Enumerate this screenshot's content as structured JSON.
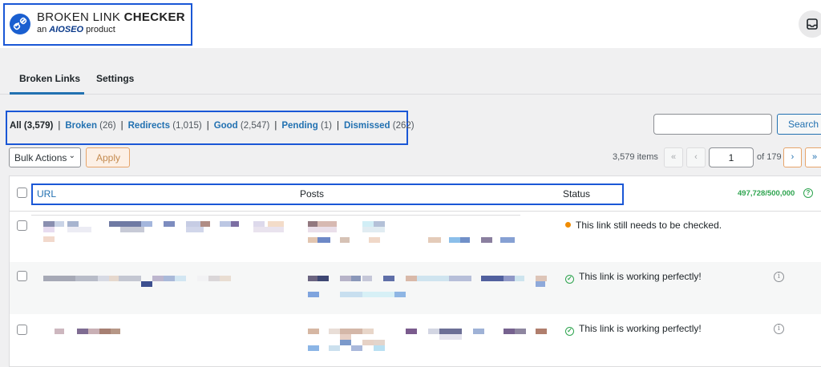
{
  "header": {
    "logo_text_light": "BROKEN LINK ",
    "logo_text_bold": "CHECKER",
    "logo_sub_prefix": "an ",
    "logo_sub_brand": "AIOSEO",
    "logo_sub_suffix": " product",
    "inbox_icon": "inbox-icon"
  },
  "tabs": [
    {
      "label": "Broken Links",
      "active": true
    },
    {
      "label": "Settings",
      "active": false
    }
  ],
  "filters": {
    "all_label": "All",
    "all_count": "(3,579)",
    "broken_label": "Broken",
    "broken_count": "(26)",
    "redirects_label": "Redirects",
    "redirects_count": "(1,015)",
    "good_label": "Good",
    "good_count": "(2,547)",
    "pending_label": "Pending",
    "pending_count": "(1)",
    "dismissed_label": "Dismissed",
    "dismissed_count": "(262)",
    "separator": "|"
  },
  "search": {
    "placeholder": "",
    "button_label": "Search"
  },
  "toolbar": {
    "bulk_actions_label": "Bulk Actions",
    "apply_label": "Apply"
  },
  "pagination": {
    "items_label": "3,579 items",
    "first": "«",
    "prev": "‹",
    "current_page": "1",
    "of_label": "of 179",
    "next": "›",
    "last": "»"
  },
  "table": {
    "columns": [
      "URL",
      "Posts",
      "Status"
    ],
    "usage": "497,728/500,000",
    "rows": [
      {
        "status": "This link still needs to be checked.",
        "status_type": "pending"
      },
      {
        "status": "This link is working perfectly!",
        "status_type": "ok"
      },
      {
        "status": "This link is working perfectly!",
        "status_type": "ok"
      }
    ]
  },
  "colors": {
    "accent": "#2271b1",
    "highlight_border": "#1a57d6",
    "pending": "#f08c00",
    "ok": "#2ea44f",
    "apply": "#e6a46a"
  }
}
